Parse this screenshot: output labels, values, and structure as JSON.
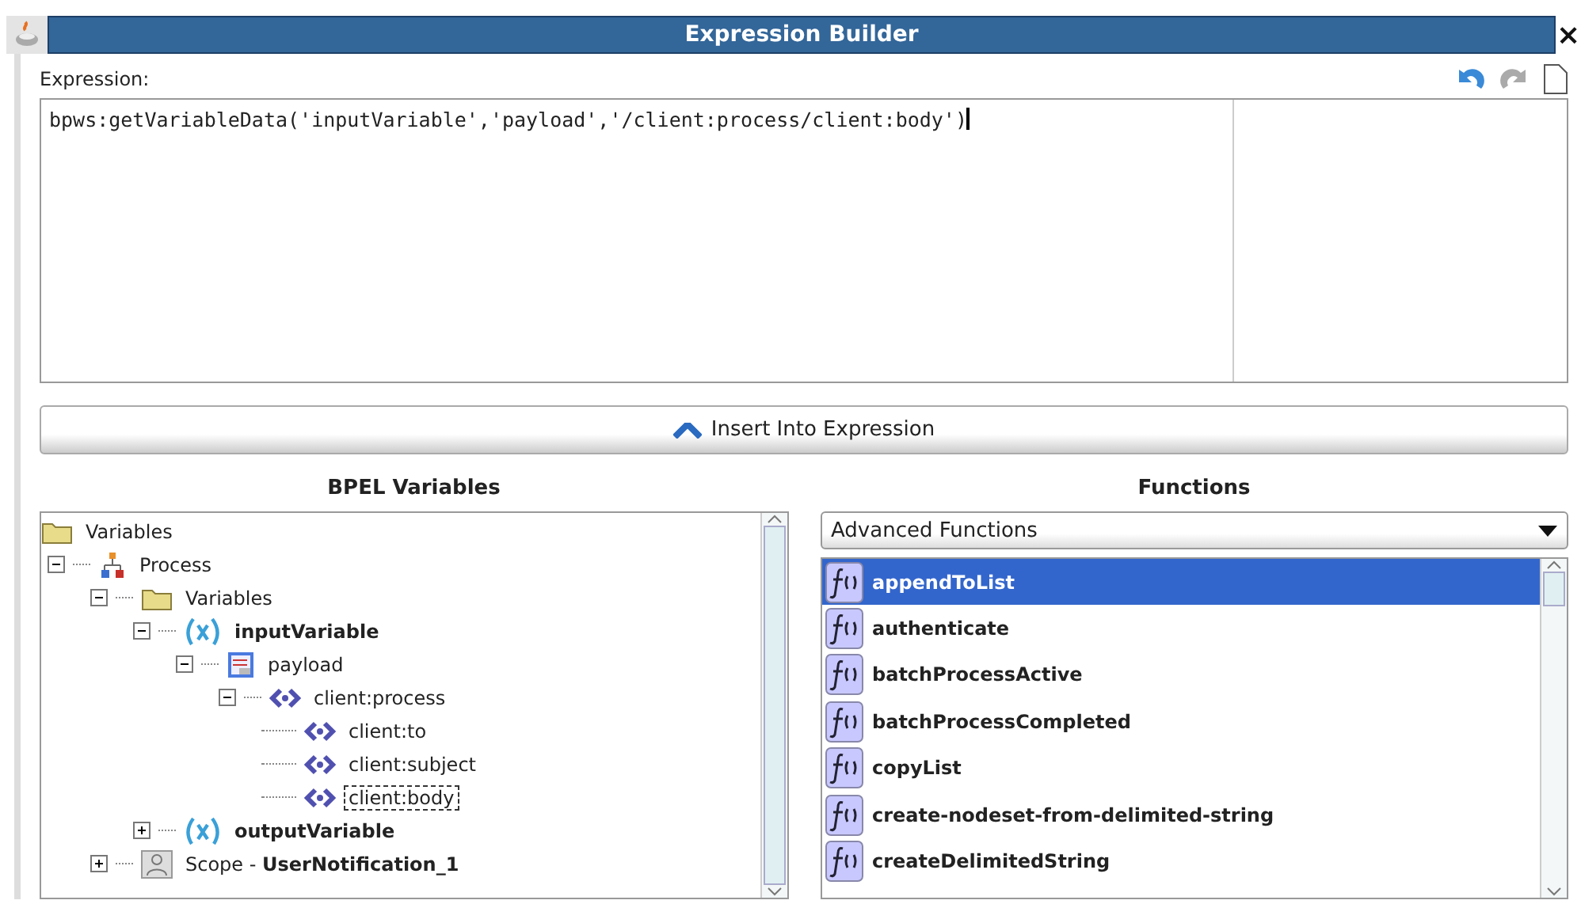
{
  "window": {
    "title": "Expression Builder",
    "close": "×"
  },
  "expression": {
    "label": "Expression:",
    "value": "bpws:getVariableData('inputVariable','payload','/client:process/client:body')"
  },
  "insert_button": {
    "label": "Insert Into Expression"
  },
  "bpel_variables": {
    "title": "BPEL Variables",
    "tree": [
      {
        "label": "Variables",
        "kind": "folder",
        "selected": false,
        "children": [
          {
            "label": "Process",
            "kind": "process",
            "expanded": true,
            "selected": false,
            "children": [
              {
                "label": "Variables",
                "kind": "folder",
                "expanded": true,
                "selected": false,
                "children": [
                  {
                    "label": "inputVariable",
                    "kind": "variable",
                    "expanded": true,
                    "selected": false,
                    "children": [
                      {
                        "label": "payload",
                        "kind": "part",
                        "expanded": true,
                        "selected": false,
                        "children": [
                          {
                            "label": "client:process",
                            "kind": "element",
                            "expanded": true,
                            "selected": false,
                            "children": [
                              {
                                "label": "client:to",
                                "kind": "element",
                                "selected": false
                              },
                              {
                                "label": "client:subject",
                                "kind": "element",
                                "selected": false
                              },
                              {
                                "label": "client:body",
                                "kind": "element",
                                "selected": true
                              }
                            ]
                          }
                        ]
                      }
                    ]
                  },
                  {
                    "label": "outputVariable",
                    "kind": "variable",
                    "expanded": false,
                    "selected": false
                  }
                ]
              },
              {
                "label": "Scope - **UserNotification_1**",
                "kind": "scope",
                "expanded": false,
                "selected": false
              }
            ]
          }
        ]
      }
    ]
  },
  "functions": {
    "title": "Functions",
    "category": "Advanced Functions",
    "items": [
      {
        "name": "appendToList",
        "selected": true
      },
      {
        "name": "authenticate",
        "selected": false
      },
      {
        "name": "batchProcessActive",
        "selected": false
      },
      {
        "name": "batchProcessCompleted",
        "selected": false
      },
      {
        "name": "copyList",
        "selected": false
      },
      {
        "name": "create-nodeset-from-delimited-string",
        "selected": false
      },
      {
        "name": "createDelimitedString",
        "selected": false
      }
    ]
  }
}
